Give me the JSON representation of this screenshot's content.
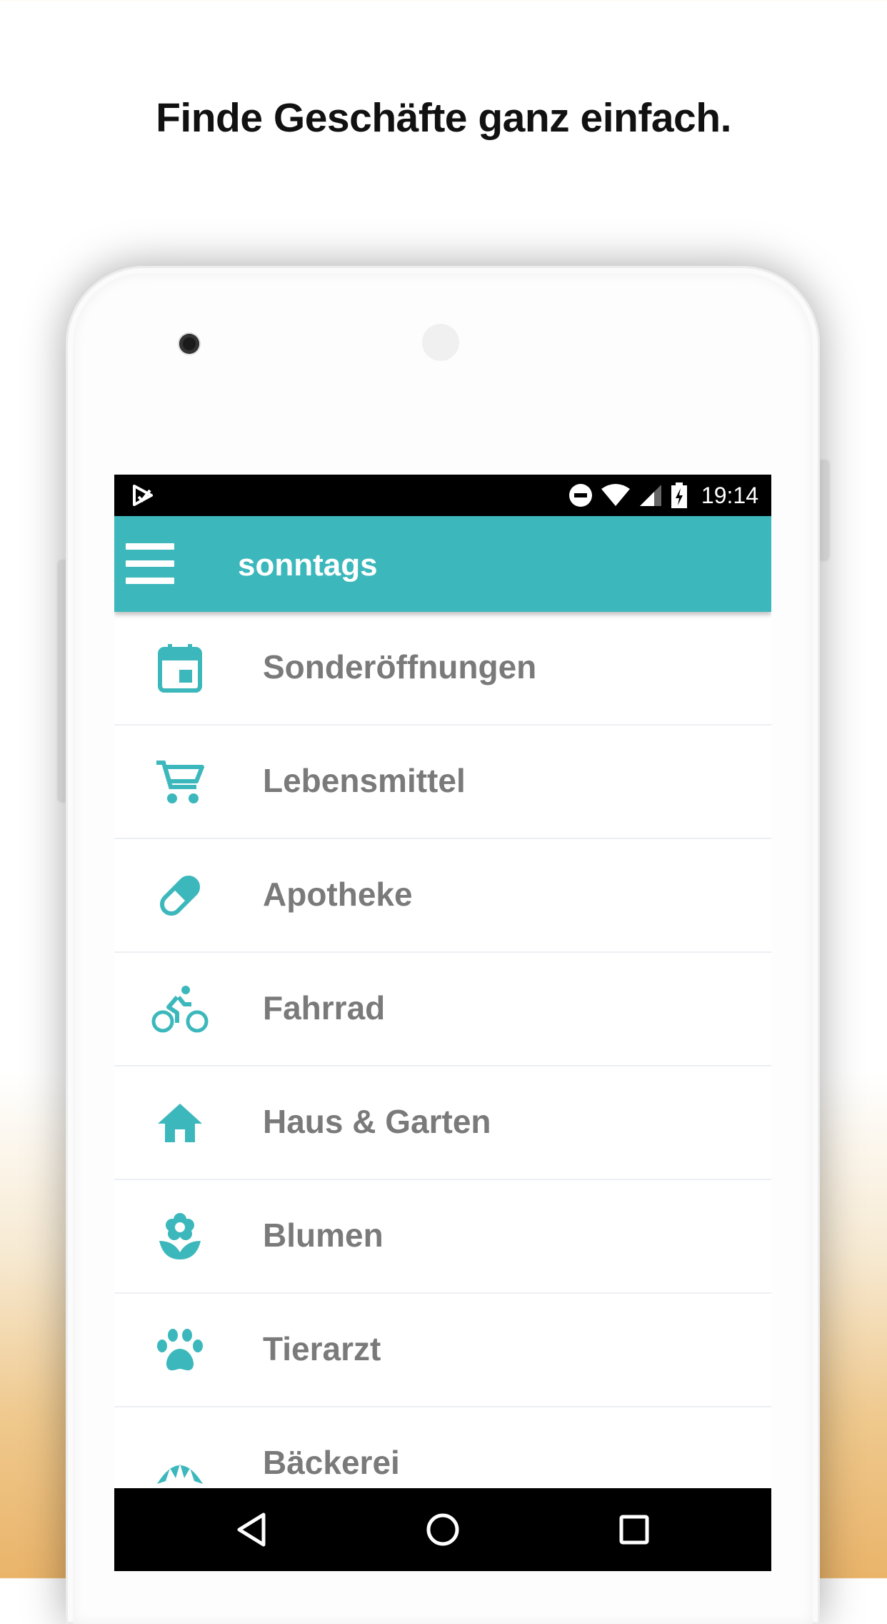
{
  "headline": "Finde Geschäfte ganz einfach.",
  "statusbar": {
    "time": "19:14",
    "icons": [
      "app-notification-icon",
      "do-not-disturb-icon",
      "wifi-icon",
      "signal-icon",
      "battery-charging-icon"
    ]
  },
  "toolbar": {
    "menu_icon": "hamburger-menu-icon",
    "title": "sonntags",
    "color": "#3cb8bc"
  },
  "categories": [
    {
      "label": "Sonderöffnungen",
      "icon": "calendar-icon"
    },
    {
      "label": "Lebensmittel",
      "icon": "shopping-cart-icon"
    },
    {
      "label": "Apotheke",
      "icon": "pill-icon"
    },
    {
      "label": "Fahrrad",
      "icon": "bicycle-icon"
    },
    {
      "label": "Haus & Garten",
      "icon": "house-icon"
    },
    {
      "label": "Blumen",
      "icon": "flower-icon"
    },
    {
      "label": "Tierarzt",
      "icon": "paw-icon"
    },
    {
      "label": "Bäckerei",
      "icon": "bread-icon"
    }
  ],
  "navbar": {
    "icons": [
      "back-icon",
      "home-icon",
      "recents-icon"
    ]
  },
  "colors": {
    "accent": "#3cb8bc",
    "label_text": "#7a7a7a"
  }
}
